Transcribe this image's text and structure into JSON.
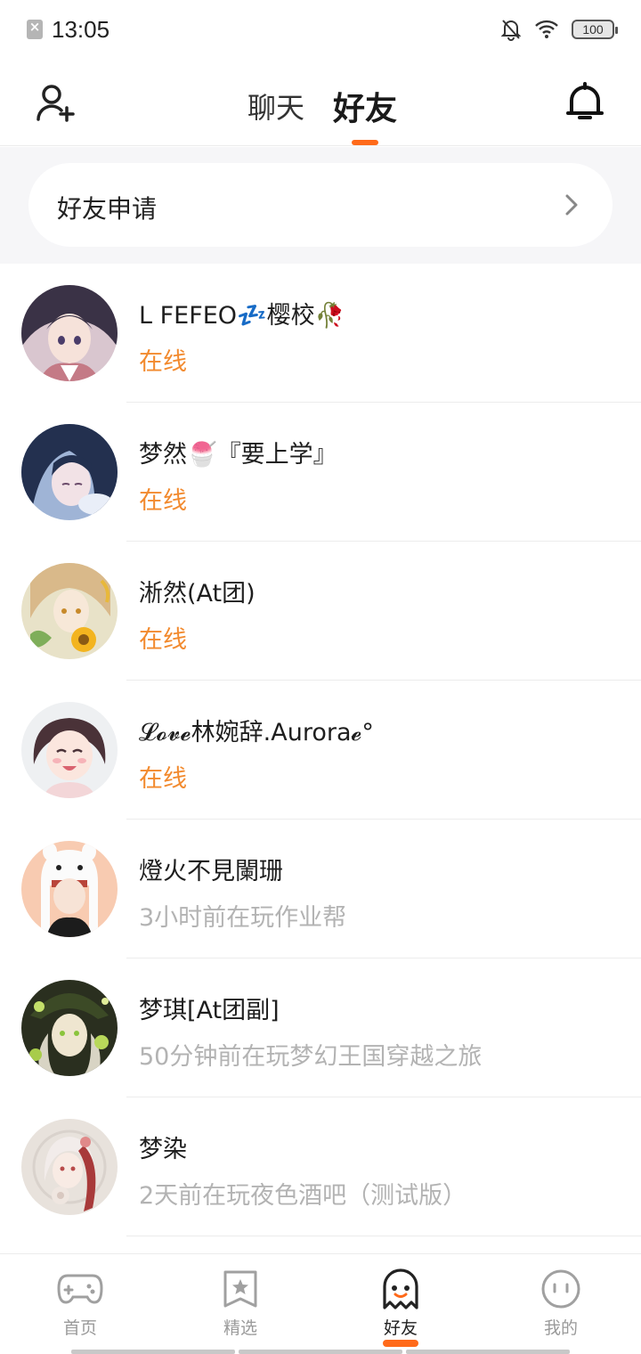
{
  "status_bar": {
    "time": "13:05",
    "battery": "100",
    "icons": [
      "sim-off-icon",
      "bell-mute-icon",
      "wifi-icon",
      "battery-icon"
    ]
  },
  "header": {
    "tabs": [
      {
        "label": "聊天",
        "active": false
      },
      {
        "label": "好友",
        "active": true
      }
    ],
    "left_icon": "add-friend-icon",
    "right_icon": "bell-icon",
    "accent_color": "#ff6a1a"
  },
  "friend_request": {
    "label": "好友申请",
    "chevron": "chevron-right-icon"
  },
  "friends": [
    {
      "name": "L FEFEO💤樱校🥀",
      "status": "在线",
      "online": true,
      "avatar": "avatar-1"
    },
    {
      "name": "梦然🍧『要上学』",
      "status": "在线",
      "online": true,
      "avatar": "avatar-2"
    },
    {
      "name": "淅然(At团)",
      "status": "在线",
      "online": true,
      "avatar": "avatar-3"
    },
    {
      "name": "𝓛𝓸𝓿𝓮林婉辞.Aurora𝓮°",
      "status": "在线",
      "online": true,
      "avatar": "avatar-4"
    },
    {
      "name": "燈火不見闌珊",
      "status": "3小时前在玩作业帮",
      "online": false,
      "avatar": "avatar-5"
    },
    {
      "name": "梦琪[At团副]",
      "status": "50分钟前在玩梦幻王国穿越之旅",
      "online": false,
      "avatar": "avatar-6"
    },
    {
      "name": "梦染",
      "status": "2天前在玩夜色酒吧（测试版）",
      "online": false,
      "avatar": "avatar-7"
    }
  ],
  "colors": {
    "online": "#f28a2e",
    "offline": "#b3b3b3",
    "accent": "#ff6a1a"
  },
  "bottom_nav": [
    {
      "label": "首页",
      "icon": "gamepad-icon",
      "active": false
    },
    {
      "label": "精选",
      "icon": "star-badge-icon",
      "active": false
    },
    {
      "label": "好友",
      "icon": "ghost-icon",
      "active": true
    },
    {
      "label": "我的",
      "icon": "face-icon",
      "active": false
    }
  ]
}
